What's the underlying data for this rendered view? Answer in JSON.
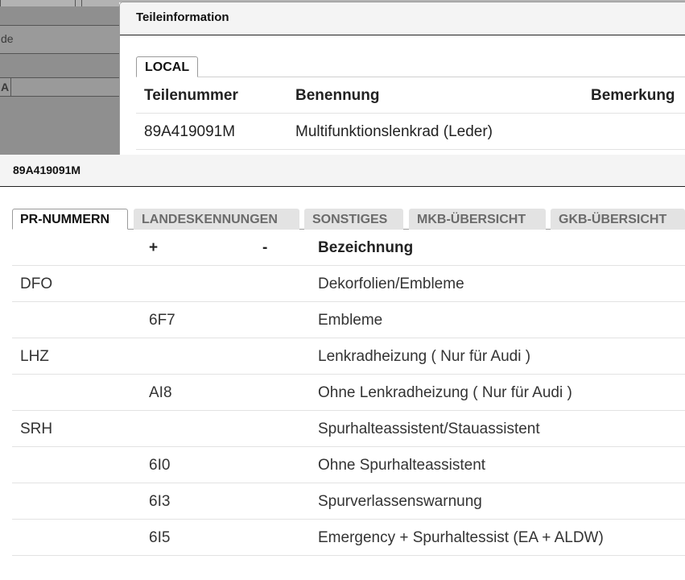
{
  "background_window": {
    "field_1": "de",
    "field_2": "A"
  },
  "dialog": {
    "title": "Teileinformation",
    "tabs": [
      {
        "label": "LOCAL"
      }
    ],
    "columns": [
      "Teilenummer",
      "Benennung",
      "Bemerkung"
    ],
    "rows": [
      {
        "teilenummer": "89A419091M",
        "benennung": "Multifunktionslenkrad (Leder)",
        "bemerkung": ""
      }
    ]
  },
  "panel": {
    "title": "89A419091M",
    "tabs": [
      {
        "label": "PR-NUMMERN",
        "active": true
      },
      {
        "label": "LANDESKENNUNGEN",
        "active": false
      },
      {
        "label": "SONSTIGES",
        "active": false
      },
      {
        "label": "MKB-ÜBERSICHT",
        "active": false
      },
      {
        "label": "GKB-ÜBERSICHT",
        "active": false
      }
    ],
    "columns": [
      "",
      "+",
      "-",
      "Bezeichnung"
    ],
    "rows": [
      {
        "family": "DFO",
        "plus": "",
        "minus": "",
        "bezeichnung": "Dekorfolien/Embleme"
      },
      {
        "family": "",
        "plus": "6F7",
        "minus": "",
        "bezeichnung": "Embleme"
      },
      {
        "family": "LHZ",
        "plus": "",
        "minus": "",
        "bezeichnung": "Lenkradheizung ( Nur für Audi )"
      },
      {
        "family": "",
        "plus": "AI8",
        "minus": "",
        "bezeichnung": "Ohne Lenkradheizung ( Nur für Audi )"
      },
      {
        "family": "SRH",
        "plus": "",
        "minus": "",
        "bezeichnung": "Spurhalteassistent/Stauassistent"
      },
      {
        "family": "",
        "plus": "6I0",
        "minus": "",
        "bezeichnung": "Ohne Spurhalteassistent"
      },
      {
        "family": "",
        "plus": "6I3",
        "minus": "",
        "bezeichnung": "Spurverlassenswarnung"
      },
      {
        "family": "",
        "plus": "6I5",
        "minus": "",
        "bezeichnung": "Emergency + Spurhaltessist (EA + ALDW)"
      }
    ]
  }
}
